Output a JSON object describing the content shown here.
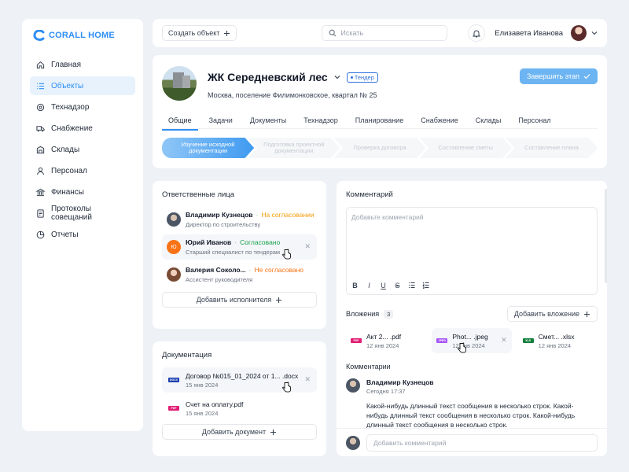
{
  "brand": {
    "name": "CORALL HOME",
    "accent": "#2d8ef5"
  },
  "sidebar": {
    "items": [
      {
        "label": "Главная",
        "icon": "home-icon",
        "active": false
      },
      {
        "label": "Объекты",
        "icon": "list-icon",
        "active": true
      },
      {
        "label": "Технадзор",
        "icon": "inspect-icon",
        "active": false
      },
      {
        "label": "Снабжение",
        "icon": "truck-icon",
        "active": false
      },
      {
        "label": "Склады",
        "icon": "warehouse-icon",
        "active": false
      },
      {
        "label": "Персонал",
        "icon": "person-icon",
        "active": false
      },
      {
        "label": "Финансы",
        "icon": "finance-icon",
        "active": false
      },
      {
        "label": "Протоколы совещаний",
        "icon": "protocol-icon",
        "active": false
      },
      {
        "label": "Отчеты",
        "icon": "report-icon",
        "active": false
      }
    ]
  },
  "header": {
    "create_label": "Создать объект",
    "search_placeholder": "Искать",
    "user_name": "Елизавета Иванова"
  },
  "project": {
    "title": "ЖК Середневский лес",
    "badge": "Тендер",
    "address": "Москва, поселение Филимонковское, квартал № 25",
    "finish_label": "Завершить этап",
    "tabs": [
      "Общие",
      "Задачи",
      "Документы",
      "Технадзор",
      "Планирование",
      "Снабжение",
      "Склады",
      "Персонал"
    ],
    "active_tab": 0,
    "stages": [
      "Изучение исходной документации",
      "Подготовка проектной документации",
      "Проверка договора",
      "Составление сметы",
      "Составление плана"
    ]
  },
  "responsible": {
    "title": "Ответственные лица",
    "people": [
      {
        "name": "Владимир Кузнецов",
        "status": "На согласовании",
        "status_kind": "pending",
        "role": "Директор по строительству"
      },
      {
        "name": "Юрий Иванов",
        "status": "Согласовано",
        "status_kind": "ok",
        "role": "Старший специалист по тендерам",
        "initials": "Ю"
      },
      {
        "name": "Валерия Соколо...",
        "status": "Не согласовано",
        "status_kind": "no",
        "role": "Ассистент руководителя"
      }
    ],
    "add_label": "Добавить исполнителя"
  },
  "documents": {
    "title": "Документация",
    "items": [
      {
        "name": "Договор №015_01_2024 от 1... .docx",
        "date": "15 янв 2024",
        "type": "DOCX"
      },
      {
        "name": "Счет на оплату.pdf",
        "date": "15 янв 2024",
        "type": "PDF"
      }
    ],
    "add_label": "Добавить документ"
  },
  "comment_box": {
    "title": "Комментарий",
    "placeholder": "Добавьте комментарий",
    "toolbar": [
      "B",
      "I",
      "U",
      "S"
    ]
  },
  "attachments": {
    "title": "Вложения",
    "count": "3",
    "add_label": "Добавить вложение",
    "items": [
      {
        "name": "Акт 2... .pdf",
        "date": "12 янв 2024",
        "type": "PDF"
      },
      {
        "name": "Phot... .jpeg",
        "date": "12 янв 2024",
        "type": "JPEG"
      },
      {
        "name": "Смет... .xlsx",
        "date": "12 янв 2024",
        "type": "XLS"
      }
    ]
  },
  "comments": {
    "title": "Комментарии",
    "items": [
      {
        "author": "Владимир Кузнецов",
        "time": "Сегодня 17:37",
        "text": "Какой-нибудь длинный текст сообщения в несколько строк. Какой-нибудь длинный текст сообщения в несколько строк. Какой-нибудь длинный текст сообщения в несколько строк."
      }
    ],
    "input_placeholder": "Добавить комментарий"
  }
}
